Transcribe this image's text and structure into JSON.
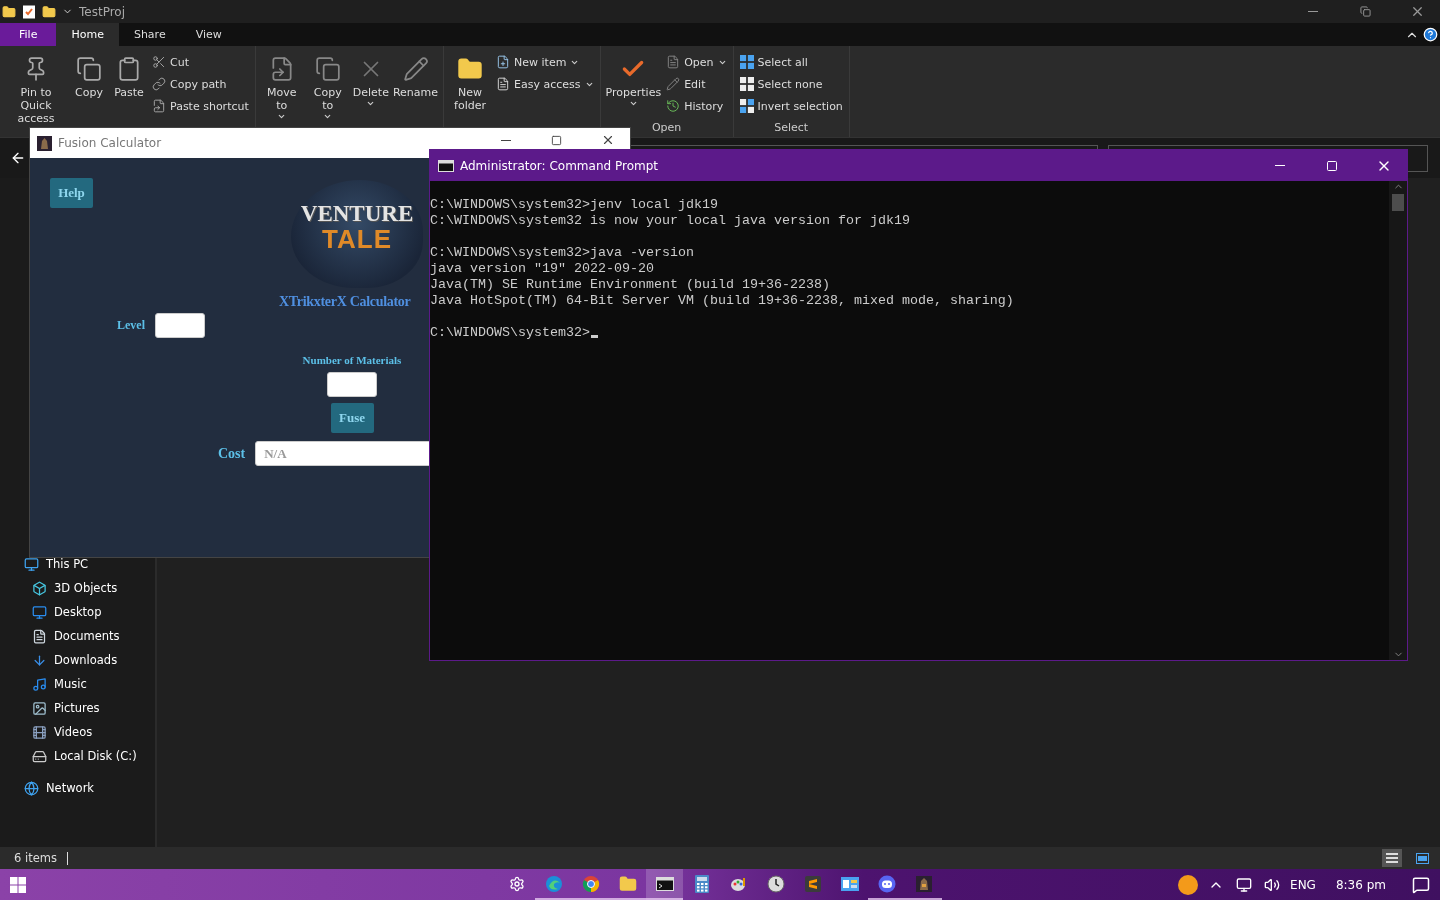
{
  "explorer": {
    "title": "TestProj",
    "file_menu": "File",
    "ribbon_tabs": [
      {
        "label": "Home",
        "selected": true
      },
      {
        "label": "Share",
        "selected": false
      },
      {
        "label": "View",
        "selected": false
      }
    ],
    "ribbon_groups": [
      {
        "commands": [
          {
            "label": "Pin to Quick access",
            "kind": "large"
          },
          {
            "label": "Copy",
            "kind": "large"
          },
          {
            "label": "Paste",
            "kind": "large"
          },
          {
            "label": "Cut",
            "kind": "small"
          },
          {
            "label": "Copy path",
            "kind": "small"
          },
          {
            "label": "Paste shortcut",
            "kind": "small"
          }
        ]
      },
      {
        "commands": [
          {
            "label": "Move to",
            "kind": "large-drop"
          },
          {
            "label": "Copy to",
            "kind": "large-drop"
          },
          {
            "label": "Delete",
            "kind": "large-drop"
          },
          {
            "label": "Rename",
            "kind": "large"
          }
        ]
      },
      {
        "commands": [
          {
            "label": "New folder",
            "kind": "large"
          },
          {
            "label": "New item",
            "kind": "small-drop"
          },
          {
            "label": "Easy access",
            "kind": "small-drop"
          }
        ]
      },
      {
        "label": "Open",
        "commands": [
          {
            "label": "Properties",
            "kind": "large-drop"
          },
          {
            "label": "Open",
            "kind": "small-drop"
          },
          {
            "label": "Edit",
            "kind": "small"
          },
          {
            "label": "History",
            "kind": "small"
          }
        ]
      },
      {
        "label": "Select",
        "commands": [
          {
            "label": "Select all",
            "kind": "small"
          },
          {
            "label": "Select none",
            "kind": "small"
          },
          {
            "label": "Invert selection",
            "kind": "small"
          }
        ]
      }
    ],
    "sidebar": [
      {
        "label": "This PC",
        "children": [
          {
            "label": "3D Objects"
          },
          {
            "label": "Desktop"
          },
          {
            "label": "Documents"
          },
          {
            "label": "Downloads"
          },
          {
            "label": "Music"
          },
          {
            "label": "Pictures"
          },
          {
            "label": "Videos"
          },
          {
            "label": "Local Disk (C:)"
          }
        ]
      },
      {
        "label": "Network"
      }
    ],
    "status_bar": {
      "item_count": "6 items"
    }
  },
  "fusion_window": {
    "title": "Fusion Calculator",
    "help_button": "Help",
    "logo": {
      "line_1": "VENTURE",
      "line_2": "TALE"
    },
    "heading": "XTrikxterX Calculator",
    "level_label": "Level",
    "materials_label": "Number of Materials",
    "fuse_button": "Fuse",
    "cost_label": "Cost",
    "cost_placeholder": "N/A"
  },
  "console_window": {
    "title": "Administrator: Command Prompt",
    "blocks": [
      [
        "C:\\WINDOWS\\system32>jenv local jdk19",
        "C:\\WINDOWS\\system32 is now your local java version for jdk19"
      ],
      [
        "C:\\WINDOWS\\system32>java -version",
        "java version \"19\" 2022-09-20",
        "Java(TM) SE Runtime Environment (build 19+36-2238)",
        "Java HotSpot(TM) 64-Bit Server VM (build 19+36-2238, mixed mode, sharing)"
      ],
      [
        "C:\\WINDOWS\\system32>"
      ]
    ]
  },
  "taskbar": {
    "apps": [
      {
        "kind": "settings",
        "running": false,
        "focused": false
      },
      {
        "kind": "edge",
        "running": true,
        "focused": false
      },
      {
        "kind": "chrome",
        "running": true,
        "focused": false
      },
      {
        "kind": "folder",
        "running": true,
        "focused": false
      },
      {
        "kind": "console",
        "running": true,
        "focused": true
      },
      {
        "kind": "calculator",
        "running": false,
        "focused": false
      },
      {
        "kind": "paint",
        "running": false,
        "focused": false
      },
      {
        "kind": "clock",
        "running": false,
        "focused": false
      },
      {
        "kind": "sublime",
        "running": false,
        "focused": false
      },
      {
        "kind": "panel",
        "running": false,
        "focused": false
      },
      {
        "kind": "discord",
        "running": true,
        "focused": false
      },
      {
        "kind": "game",
        "running": true,
        "focused": false
      }
    ],
    "language": "ENG",
    "time": "8:36 pm"
  }
}
